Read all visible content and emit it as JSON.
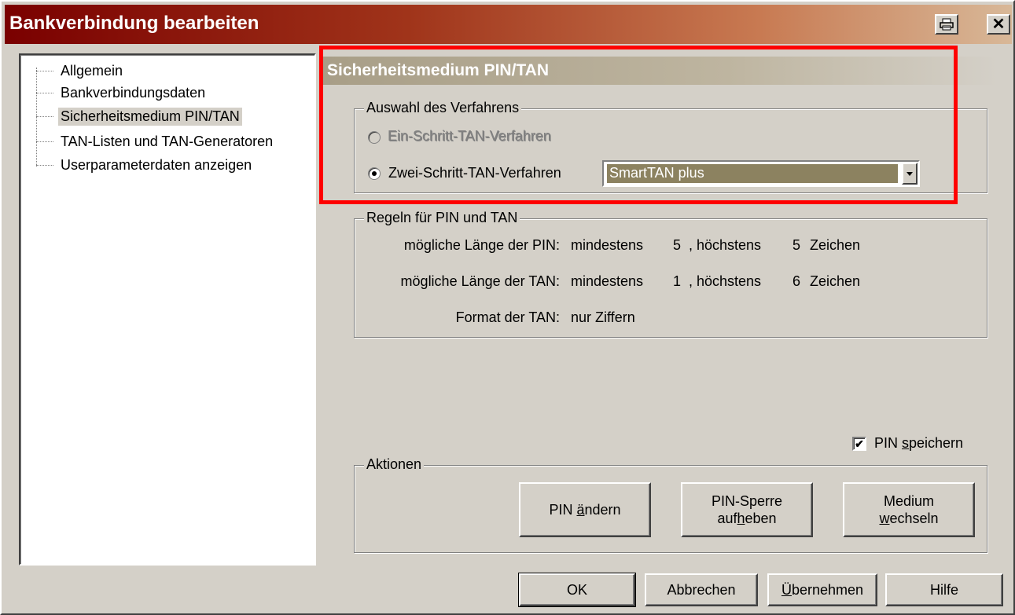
{
  "window": {
    "title": "Bankverbindung bearbeiten",
    "print_icon": "printer-icon",
    "close_label": "✕"
  },
  "tree": {
    "items": [
      {
        "label": "Allgemein",
        "selected": false
      },
      {
        "label": "Bankverbindungsdaten",
        "selected": false
      },
      {
        "label": "Sicherheitsmedium PIN/TAN",
        "selected": true
      },
      {
        "label": "TAN-Listen und TAN-Generatoren",
        "selected": false
      },
      {
        "label": "Userparameterdaten anzeigen",
        "selected": false
      }
    ]
  },
  "section": {
    "header": "Sicherheitsmedium PIN/TAN"
  },
  "verfahren": {
    "legend": "Auswahl des Verfahrens",
    "option1": "Ein-Schritt-TAN-Verfahren",
    "option1_enabled": false,
    "option2": "Zwei-Schritt-TAN-Verfahren",
    "selected": "option2",
    "combo_value": "SmartTAN plus"
  },
  "regeln": {
    "legend": "Regeln für PIN und TAN",
    "pin_label": "mögliche Länge der PIN:",
    "pin_min_word": "mindestens",
    "pin_min": "5",
    "pin_max_word": ", höchstens",
    "pin_max": "5",
    "pin_unit": "Zeichen",
    "tan_label": "mögliche Länge der TAN:",
    "tan_min_word": "mindestens",
    "tan_min": "1",
    "tan_max_word": ", höchstens",
    "tan_max": "6",
    "tan_unit": "Zeichen",
    "format_label": "Format der TAN:",
    "format_value": "nur Ziffern"
  },
  "pin_speichern": {
    "label_pre": "PIN ",
    "label_accel": "s",
    "label_post": "peichern",
    "checked": true
  },
  "aktionen": {
    "legend": "Aktionen",
    "pin_aendern_pre": "PIN ",
    "pin_aendern_accel": "ä",
    "pin_aendern_post": "ndern",
    "pin_sperre_line1": "PIN-Sperre",
    "pin_sperre_pre": "auf",
    "pin_sperre_accel": "h",
    "pin_sperre_post": "eben",
    "medium_line1": "Medium",
    "medium_accel": "w",
    "medium_post": "echseln"
  },
  "footer": {
    "ok": "OK",
    "abbrechen": "Abbrechen",
    "uebernehmen_accel": "Ü",
    "uebernehmen_post": "bernehmen",
    "hilfe": "Hilfe"
  }
}
